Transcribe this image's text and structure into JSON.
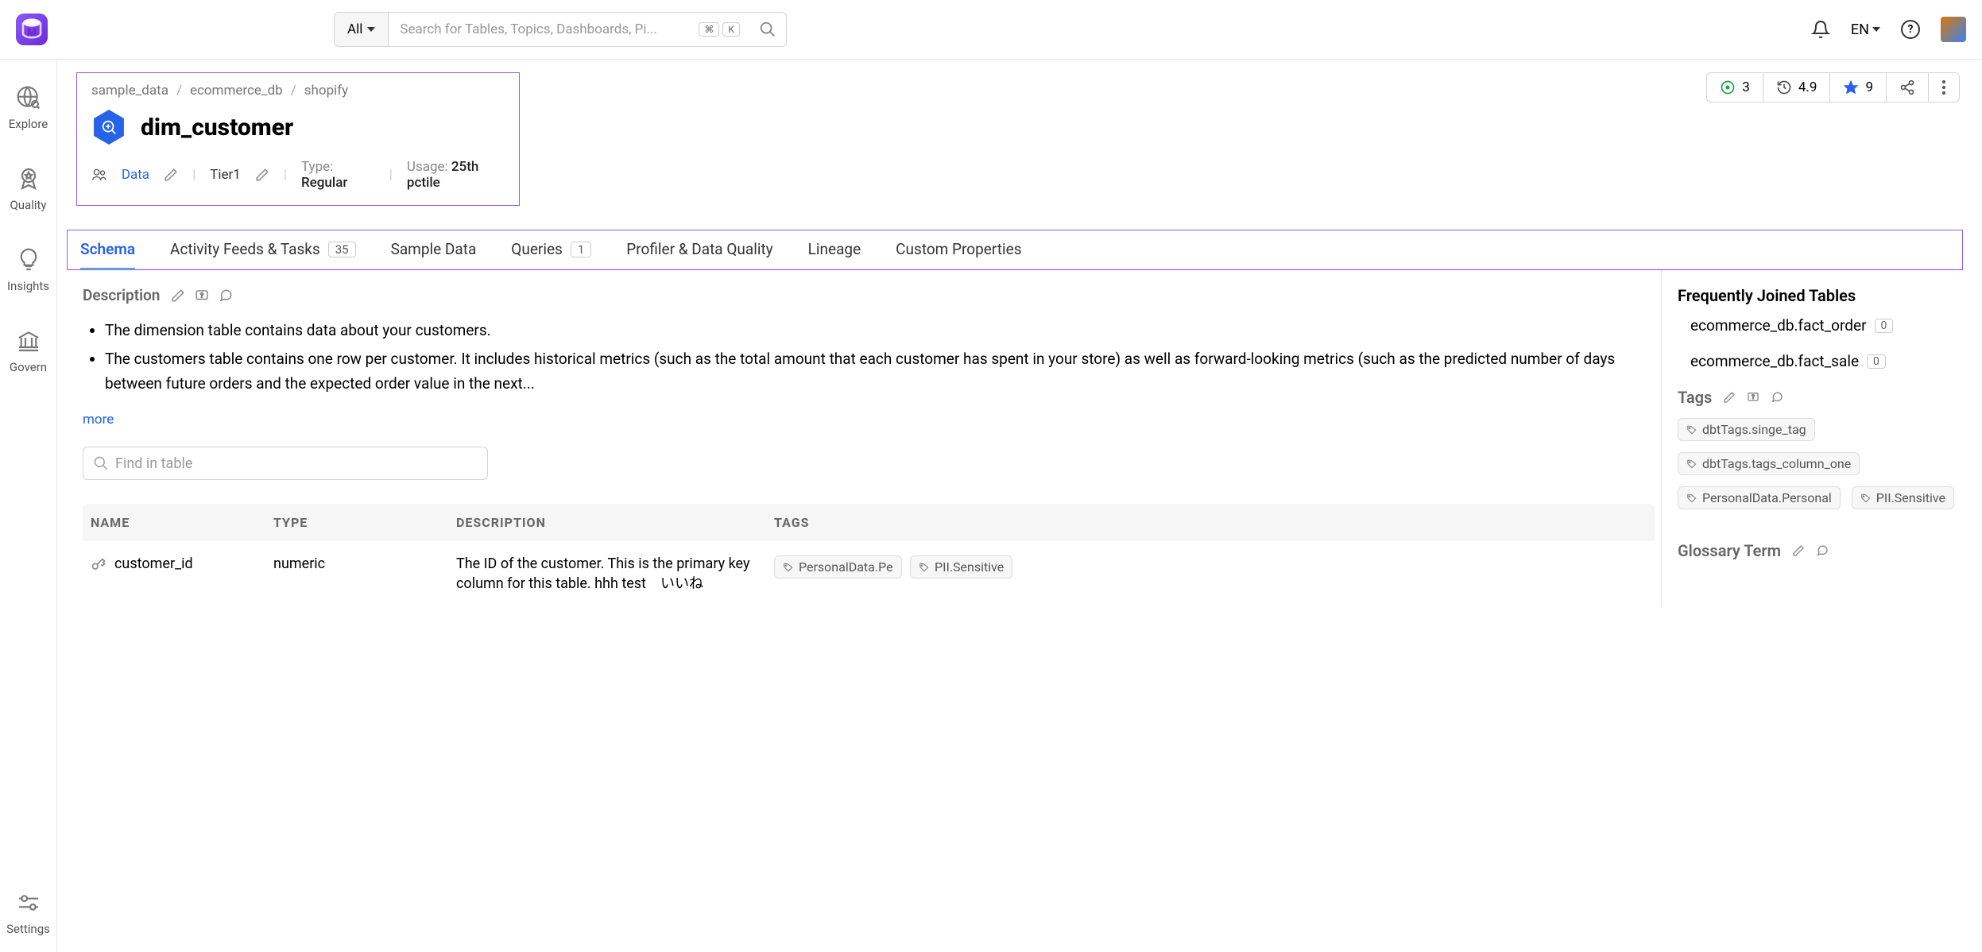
{
  "topbar": {
    "search_scope": "All",
    "search_placeholder": "Search for Tables, Topics, Dashboards, Pi...",
    "kbd1": "⌘",
    "kbd2": "K",
    "lang": "EN"
  },
  "sidebar": {
    "items": [
      {
        "label": "Explore"
      },
      {
        "label": "Quality"
      },
      {
        "label": "Insights"
      },
      {
        "label": "Govern"
      },
      {
        "label": "Settings"
      }
    ]
  },
  "stats": {
    "conversations": "3",
    "version": "4.9",
    "stars": "9"
  },
  "breadcrumb": [
    "sample_data",
    "ecommerce_db",
    "shopify"
  ],
  "title": "dim_customer",
  "meta": {
    "owner_label": "Data",
    "tier": "Tier1",
    "type_label": "Type: ",
    "type_value": "Regular",
    "usage_label": "Usage: ",
    "usage_value": "25th pctile"
  },
  "tabs": [
    {
      "label": "Schema",
      "active": true
    },
    {
      "label": "Activity Feeds & Tasks",
      "badge": "35"
    },
    {
      "label": "Sample Data"
    },
    {
      "label": "Queries",
      "badge": "1"
    },
    {
      "label": "Profiler & Data Quality"
    },
    {
      "label": "Lineage"
    },
    {
      "label": "Custom Properties"
    }
  ],
  "description": {
    "title": "Description",
    "bullets": [
      "The dimension table contains data about your customers.",
      "The customers table contains one row per customer. It includes historical metrics (such as the total amount that each customer has spent in your store) as well as forward-looking metrics (such as the predicted number of days between future orders and the expected order value in the next..."
    ],
    "more": "more",
    "find_placeholder": "Find in table"
  },
  "schema": {
    "headers": {
      "name": "NAME",
      "type": "TYPE",
      "desc": "DESCRIPTION",
      "tags": "TAGS"
    },
    "rows": [
      {
        "name": "customer_id",
        "type": "numeric",
        "desc": "The ID of the customer. This is the primary key column for this table. hhh test　いいね",
        "tags": [
          "PersonalData.Pe",
          "PII.Sensitive"
        ]
      }
    ]
  },
  "right": {
    "joined_title": "Frequently Joined Tables",
    "joined": [
      {
        "name": "ecommerce_db.fact_order",
        "count": "0"
      },
      {
        "name": "ecommerce_db.fact_sale",
        "count": "0"
      }
    ],
    "tags_title": "Tags",
    "tags": [
      "dbtTags.singe_tag",
      "dbtTags.tags_column_one",
      "PersonalData.Personal",
      "PII.Sensitive"
    ],
    "glossary_title": "Glossary Term"
  }
}
